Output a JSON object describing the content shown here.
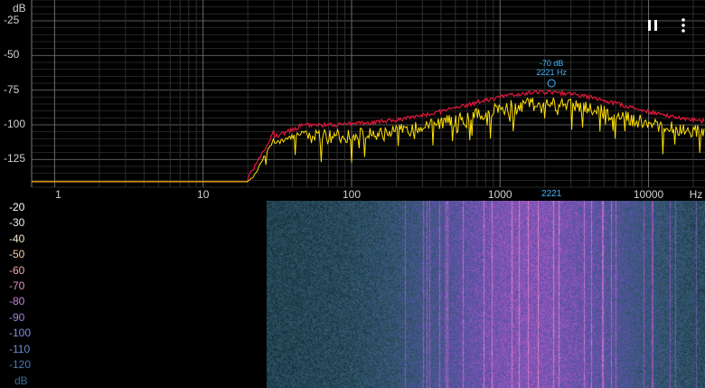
{
  "spectrum": {
    "y_unit": "dB",
    "y_ticks": [
      "-25",
      "-50",
      "-75",
      "-100",
      "-125"
    ],
    "x_unit": "Hz",
    "x_ticks": [
      "1",
      "10",
      "100",
      "1000",
      "10000"
    ],
    "peak": {
      "db_label": "-70 dB",
      "hz_label": "2221 Hz",
      "x_axis_label": "2221",
      "hz": 2221,
      "db": -70
    }
  },
  "spectrogram": {
    "scale_labels": [
      "-20",
      "-30",
      "-40",
      "-50",
      "-60",
      "-70",
      "-80",
      "-90",
      "-100",
      "-110",
      "-120"
    ],
    "unit": "dB"
  },
  "controls": {
    "pause_icon": "pause-icon",
    "menu_icon": "more-vertical-icon"
  },
  "colors": {
    "background": "#000000",
    "grid": "#3a3a3a",
    "live_trace": "#ffe100",
    "peak_hold_trace": "#e0183c",
    "marker": "#41b8ff"
  }
}
